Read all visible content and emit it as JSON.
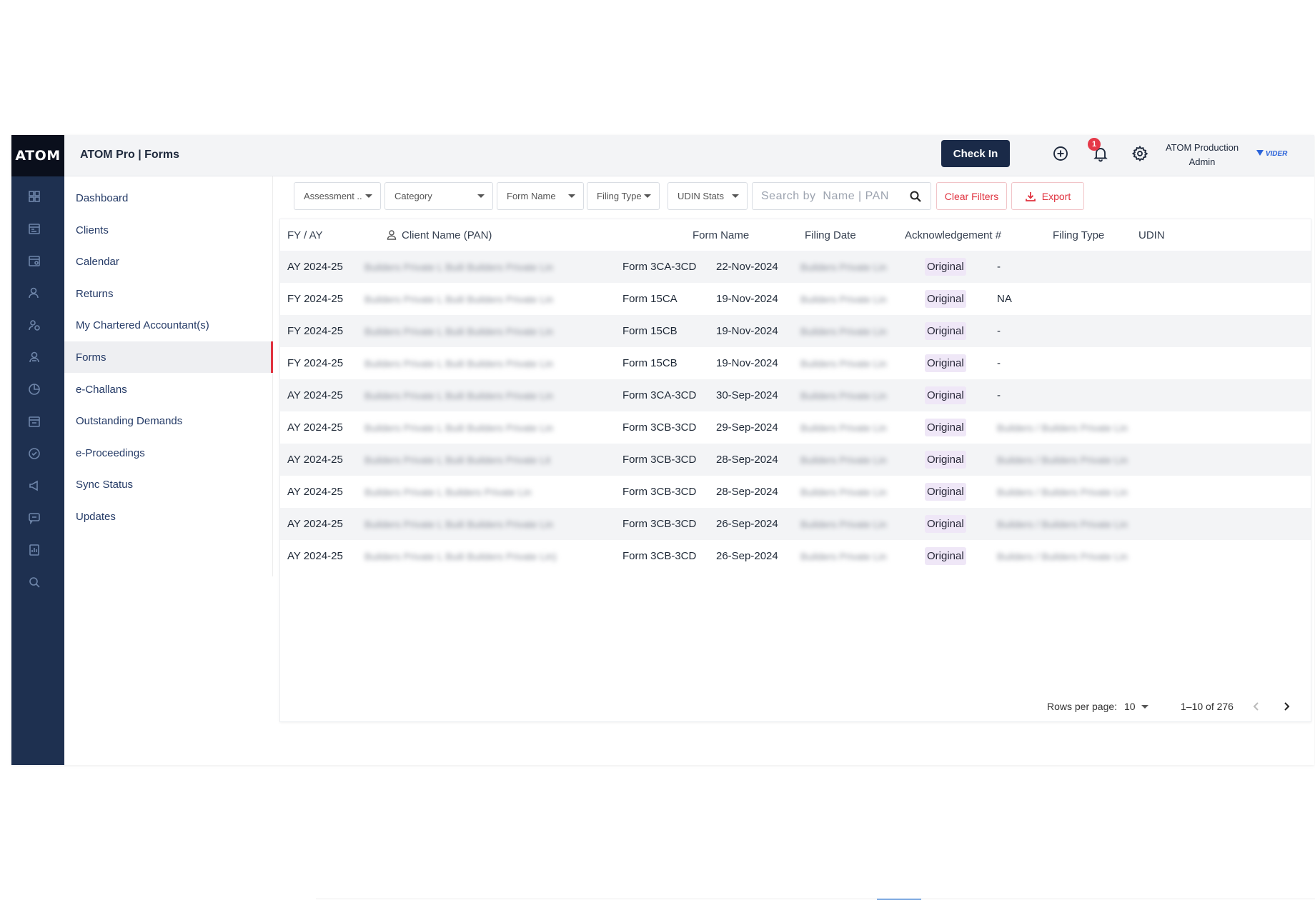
{
  "app": {
    "logo": "ATOM",
    "title": "ATOM Pro | Forms"
  },
  "header": {
    "check_in_label": "Check In",
    "notification_count": "1",
    "user_name": "ATOM Production",
    "user_role": "Admin",
    "brand_mark": "VIDER"
  },
  "rail_icons": [
    "dashboard-icon",
    "clients-icon",
    "calendar-icon",
    "returns-icon",
    "accountants-icon",
    "forms-icon",
    "challans-icon",
    "demands-icon",
    "proceedings-icon",
    "megaphone-icon",
    "chat-icon",
    "report-icon",
    "search-icon"
  ],
  "sidebar": {
    "items": [
      {
        "label": "Dashboard",
        "active": false
      },
      {
        "label": "Clients",
        "active": false
      },
      {
        "label": "Calendar",
        "active": false
      },
      {
        "label": "Returns",
        "active": false
      },
      {
        "label": "My Chartered Accountant(s)",
        "active": false
      },
      {
        "label": "Forms",
        "active": true
      },
      {
        "label": "e-Challans",
        "active": false
      },
      {
        "label": "Outstanding Demands",
        "active": false
      },
      {
        "label": "e-Proceedings",
        "active": false
      },
      {
        "label": "Sync Status",
        "active": false
      },
      {
        "label": "Updates",
        "active": false
      }
    ]
  },
  "filters": {
    "assessment": "Assessment ..",
    "category": "Category",
    "form_name": "Form Name",
    "filing_type": "Filing Type",
    "udin_status": "UDIN Stats",
    "search_placeholder": "Search by  Name | PAN",
    "clear_label": "Clear Filters",
    "export_label": "Export"
  },
  "table": {
    "headers": {
      "fy_ay": "FY / AY",
      "client": "Client Name (PAN)",
      "form_name": "Form Name",
      "filing_date": "Filing Date",
      "ack": "Acknowledgement #",
      "filing_type": "Filing Type",
      "udin": "UDIN"
    },
    "rows": [
      {
        "fy": "AY 2024-25",
        "client": "Builders Private L Buili Builders Private Lin",
        "form": "Form 3CA-3CD",
        "date": "22-Nov-2024",
        "ack": "Builders Private Lin",
        "type": "Original",
        "udin": "-"
      },
      {
        "fy": "FY 2024-25",
        "client": "Builders Private L Buili Builders Private Lin",
        "form": "Form 15CA",
        "date": "19-Nov-2024",
        "ack": "Builders Private Lin",
        "type": "Original",
        "udin": "NA"
      },
      {
        "fy": "FY 2024-25",
        "client": "Builders Private L Buili Builders Private Lin",
        "form": "Form 15CB",
        "date": "19-Nov-2024",
        "ack": "Builders Private Lin",
        "type": "Original",
        "udin": "-"
      },
      {
        "fy": "FY 2024-25",
        "client": "Builders Private L Buili Builders Private Lin",
        "form": "Form 15CB",
        "date": "19-Nov-2024",
        "ack": "Builders Private Lin",
        "type": "Original",
        "udin": "-"
      },
      {
        "fy": "AY 2024-25",
        "client": "Builders Private L Buili Builders Private Lin",
        "form": "Form 3CA-3CD",
        "date": "30-Sep-2024",
        "ack": "Builders Private Lin",
        "type": "Original",
        "udin": "-"
      },
      {
        "fy": "AY 2024-25",
        "client": "Builders Private L Buili Builders Private Lin",
        "form": "Form 3CB-3CD",
        "date": "29-Sep-2024",
        "ack": "Builders Private Lin",
        "type": "Original",
        "udin": "Builders / Builders Private Lin"
      },
      {
        "fy": "AY 2024-25",
        "client": "Builders Private L Buili Builders Private Lit",
        "form": "Form 3CB-3CD",
        "date": "28-Sep-2024",
        "ack": "Builders Private Lin",
        "type": "Original",
        "udin": "Builders / Builders Private Lin"
      },
      {
        "fy": "AY 2024-25",
        "client": "Builders Private L Builders Private Lin",
        "form": "Form 3CB-3CD",
        "date": "28-Sep-2024",
        "ack": "Builders Private Lin",
        "type": "Original",
        "udin": "Builders / Builders Private Lin"
      },
      {
        "fy": "AY 2024-25",
        "client": "Builders Private L Buili Builders Private Lin",
        "form": "Form 3CB-3CD",
        "date": "26-Sep-2024",
        "ack": "Builders Private Lin",
        "type": "Original",
        "udin": "Builders / Builders Private Lin"
      },
      {
        "fy": "AY 2024-25",
        "client": "Builders Private L Buili Builders Private Lin)",
        "form": "Form 3CB-3CD",
        "date": "26-Sep-2024",
        "ack": "Builders Private Lin",
        "type": "Original",
        "udin": "Builders / Builders Private Lin"
      }
    ]
  },
  "pagination": {
    "rows_label": "Rows per page:",
    "rows_value": "10",
    "range": "1–10 of 276"
  },
  "colors": {
    "rail": "#1e3050",
    "logo_bg": "#0a0f1c",
    "accent_red": "#e0323f",
    "button_dark": "#1a2a48",
    "pill_bg": "#efe7f7"
  }
}
